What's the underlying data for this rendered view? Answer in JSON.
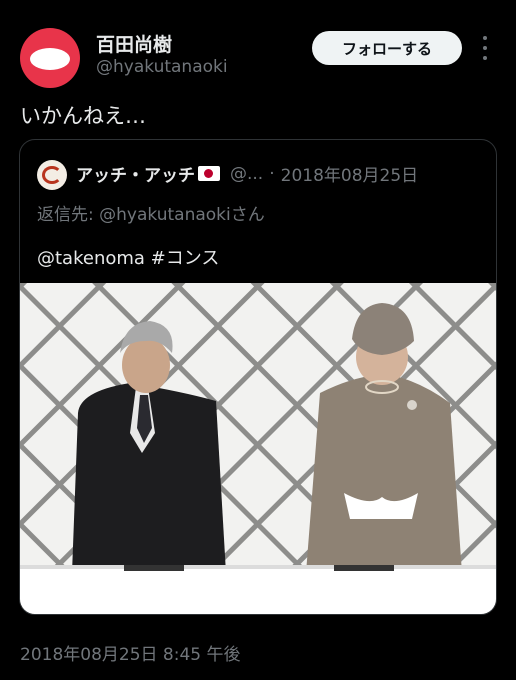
{
  "author": {
    "name": "百田尚樹",
    "handle": "@hyakutanaoki",
    "follow_label": "フォローする",
    "avatar_color": "#e8344a"
  },
  "tweet": {
    "text": "いかんねえ…",
    "timestamp": "2018年08月25日 8:45 午後"
  },
  "quoted": {
    "name": "アッチ・アッチ",
    "handle": "@...",
    "separator": "·",
    "date": "2018年08月25日",
    "reply_prefix": "返信先: ",
    "reply_handle": "@hyakutanaoki",
    "reply_suffix": "さん",
    "text": "@takenoma #コンス",
    "flag_icon": "japan-flag-icon"
  },
  "icons": {
    "more": "more-dots-vertical-icon"
  },
  "colors": {
    "background": "#000000",
    "primary_text": "#e7e9ea",
    "secondary_text": "#71767b",
    "border": "#2f3336",
    "follow_bg": "#eff3f4"
  }
}
